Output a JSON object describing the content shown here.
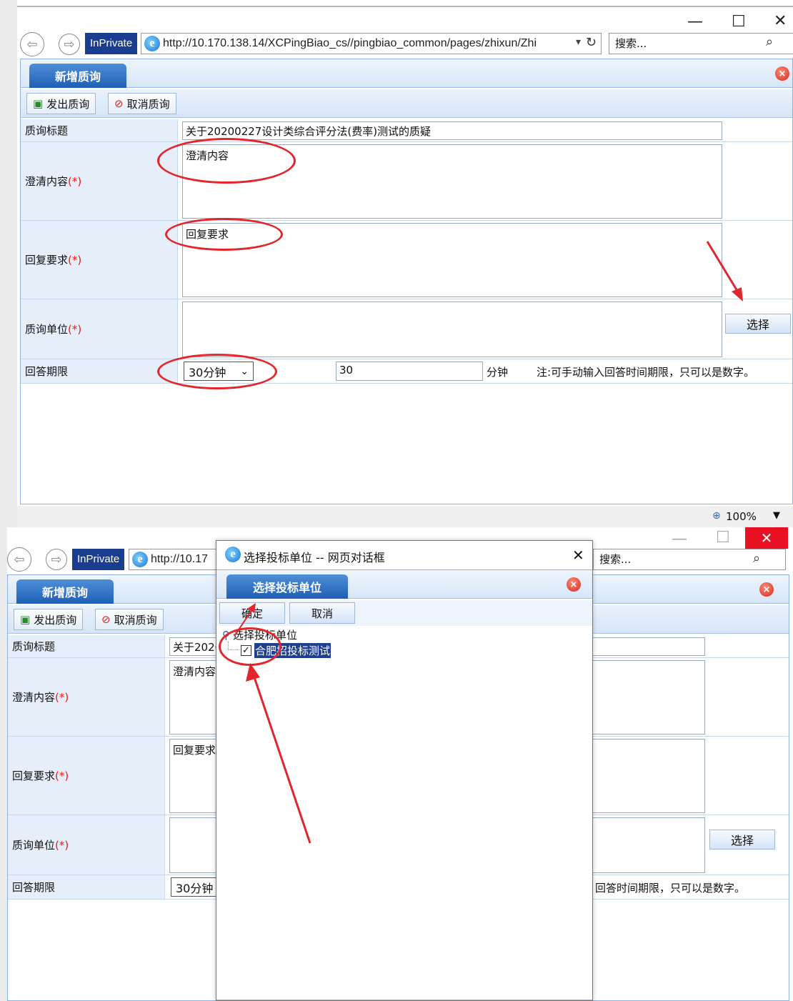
{
  "browser": {
    "inprivate_label": "InPrivate",
    "url_full": "http://10.170.138.14/XCPingBiao_cs//pingbiao_common/pages/zhixun/Zhi",
    "url_host": "http://10.170.138.14",
    "url_path": "/XCPingBiao_cs//pingbiao_common/pages/zhixun/Zhi",
    "url_truncated": "http://10.17",
    "dropdown_icon": "▾",
    "refresh_icon": "↻",
    "search_placeholder": "搜索...",
    "search_icon": "⌕",
    "zoom": "100%",
    "window_controls": {
      "minimize": "—",
      "maximize": "☐",
      "close": "✕"
    }
  },
  "form": {
    "tab_title": "新增质询",
    "toolbar": {
      "send_label": "发出质询",
      "cancel_label": "取消质询"
    },
    "fields": {
      "title_label": "质询标题",
      "title_value": "关于20200227设计类综合评分法(费率)测试的质疑",
      "title_value_truncated": "关于2020",
      "clarify_label": "澄清内容",
      "clarify_value": "澄清内容",
      "clarify_value_truncated": "澄清内容",
      "reply_label": "回复要求",
      "reply_value": "回复要求",
      "reply_value_truncated": "回复要求",
      "unit_label": "质询单位",
      "unit_value": "",
      "required_mark": "(*)",
      "deadline_label": "回答期限",
      "deadline_select": "30分钟",
      "deadline_minutes": "30",
      "minutes_unit": "分钟",
      "note": "注:可手动输入回答时间期限，只可以是数字。",
      "note_truncated": "回答时间期限，只可以是数字。",
      "select_button": "选择"
    }
  },
  "dialog": {
    "window_title": "选择投标单位 -- 网页对话框",
    "panel_title": "选择投标单位",
    "confirm_label": "确定",
    "cancel_label": "取消",
    "tree_root": "选择投标单位",
    "tree_item": "合肥招投标测试",
    "tree_item_checked": true
  },
  "colors": {
    "accent": "#1f5fb5",
    "panel_border": "#8db2e3",
    "label_bg": "#e6eef9",
    "annotation_red": "#e2262b",
    "required_red": "#e0201a",
    "inprivate_blue": "#1a3d8f"
  }
}
